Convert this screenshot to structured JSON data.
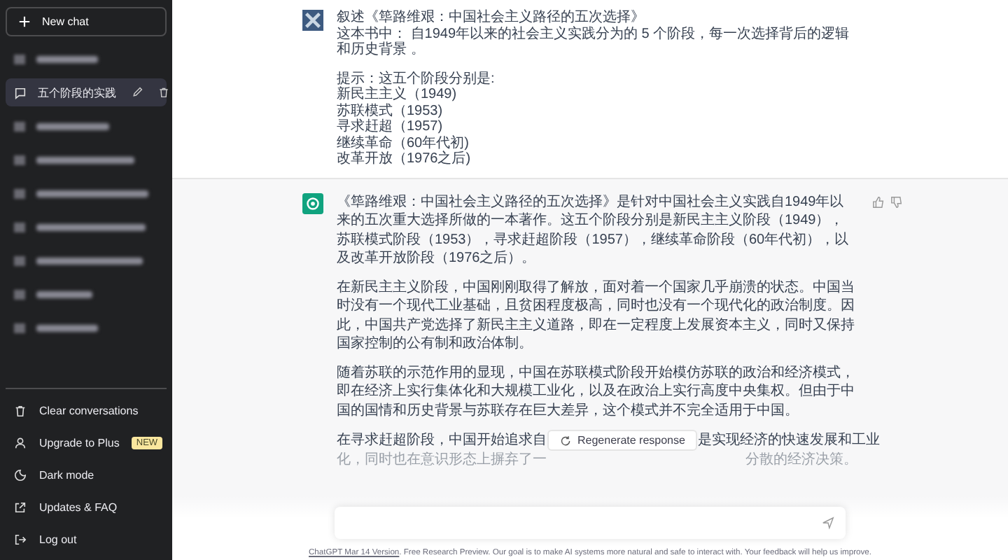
{
  "sidebar": {
    "new_chat": "New chat",
    "chats": [
      {
        "kind": "blurred",
        "selected": false
      },
      {
        "kind": "chat",
        "title": "五个阶段的实践",
        "selected": true
      },
      {
        "kind": "blurred",
        "selected": false
      },
      {
        "kind": "blurred",
        "selected": false
      },
      {
        "kind": "blurred",
        "selected": false
      },
      {
        "kind": "blurred",
        "selected": false
      },
      {
        "kind": "blurred",
        "selected": false
      },
      {
        "kind": "blurred",
        "selected": false
      },
      {
        "kind": "blurred",
        "selected": false
      }
    ],
    "menu": [
      {
        "label": "Clear conversations"
      },
      {
        "label": "Upgrade to Plus",
        "badge": "NEW"
      },
      {
        "label": "Dark mode"
      },
      {
        "label": "Updates & FAQ"
      },
      {
        "label": "Log out"
      }
    ]
  },
  "user_message": {
    "paragraphs": [
      [
        "叙述《筚路维艰：中国社会主义路径的五次选择》",
        "这本书中： 自1949年以来的社会主义实践分为的 5 个阶段，每一次选择背后的逻辑和历史背景 。"
      ],
      [
        "提示：这五个阶段分别是:",
        "新民主主义（1949)",
        "苏联模式（1953)",
        "寻求赶超（1957)",
        "继续革命（60年代初)",
        "改革开放（1976之后)"
      ]
    ]
  },
  "assistant_message": {
    "paragraphs": [
      "《筚路维艰：中国社会主义路径的五次选择》是针对中国社会主义实践自1949年以来的五次重大选择所做的一本著作。这五个阶段分别是新民主主义阶段（1949），苏联模式阶段（1953），寻求赶超阶段（1957），继续革命阶段（60年代初），以及改革开放阶段（1976之后）。",
      "在新民主主义阶段，中国刚刚取得了解放，面对着一个国家几乎崩溃的状态。中国当时没有一个现代工业基础，且贫困程度极高，同时也没有一个现代化的政治制度。因此，中国共产党选择了新民主主义道路，即在一定程度上发展资本主义，同时又保持国家控制的公有制和政治体制。",
      "随着苏联的示范作用的显现，中国在苏联模式阶段开始模仿苏联的政治和经济模式，即在经济上实行集体化和大规模工业化，以及在政治上实行高度中央集权。但由于中国的国情和历史背景与苏联存在巨大差异，这个模式并不完全适用于中国。"
    ],
    "partial_lines": [
      {
        "left": "在寻求赶超阶段，中国开始追求自",
        "right": "是实现经济的快速发展和工业"
      },
      {
        "left": "化，同时也在意识形态上摒弃了一",
        "right": "分散的经济决策。"
      }
    ]
  },
  "regenerate_button": "Regenerate response",
  "footer": {
    "link": "ChatGPT Mar 14 Version",
    "text": ". Free Research Preview. Our goal is to make AI systems more natural and safe to interact with. Your feedback will help us improve."
  }
}
